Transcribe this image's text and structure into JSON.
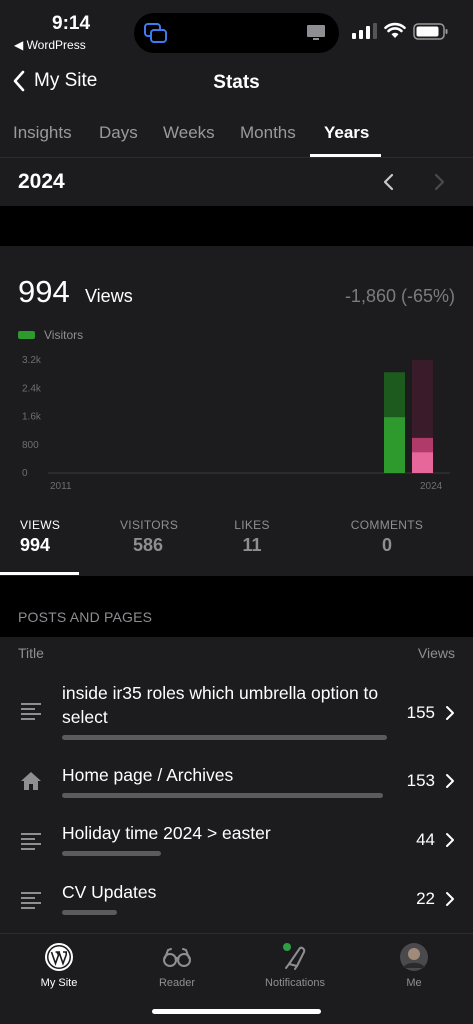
{
  "status_bar": {
    "time": "9:14",
    "back_app": "◀ WordPress"
  },
  "nav": {
    "back_label": "My Site",
    "title": "Stats"
  },
  "tabs": [
    {
      "label": "Insights"
    },
    {
      "label": "Days"
    },
    {
      "label": "Weeks"
    },
    {
      "label": "Months"
    },
    {
      "label": "Years",
      "active": true
    }
  ],
  "period": {
    "label": "2024"
  },
  "summary": {
    "views": "994",
    "views_word": "Views",
    "change": "-1,860 (-65%)"
  },
  "chart_data": {
    "type": "bar",
    "x_labels_shown": [
      "2011",
      "2024"
    ],
    "y_ticks": [
      "3.2k",
      "2.4k",
      "1.6k",
      "800",
      "0"
    ],
    "ylim": [
      0,
      3200
    ],
    "legend": [
      "Visitors"
    ],
    "series": [
      {
        "name": "Visitors",
        "color": "#2e9a2e",
        "bars": [
          {
            "x": "2023",
            "views": 2854,
            "visitors": 1580
          }
        ]
      },
      {
        "name": "Views",
        "color": "#e8679a",
        "bars": [
          {
            "x": "2024",
            "views": 994,
            "visitors": 586
          }
        ]
      }
    ]
  },
  "tiles": [
    {
      "label": "VIEWS",
      "value": "994",
      "active": true
    },
    {
      "label": "VISITORS",
      "value": "586"
    },
    {
      "label": "LIKES",
      "value": "11"
    },
    {
      "label": "COMMENTS",
      "value": "0"
    }
  ],
  "posts": {
    "section_title": "POSTS AND PAGES",
    "col_title": "Title",
    "col_views": "Views",
    "rows": [
      {
        "title": "inside ir35 roles which umbrella option to select",
        "views": "155",
        "icon": "post-lines-icon",
        "bar_fraction": 1.0
      },
      {
        "title": "Home page / Archives",
        "views": "153",
        "icon": "house-icon",
        "bar_fraction": 0.99
      },
      {
        "title": "Holiday time 2024 > easter",
        "views": "44",
        "icon": "post-lines-icon",
        "bar_fraction": 0.28
      },
      {
        "title": "CV Updates",
        "views": "22",
        "icon": "post-lines-icon",
        "bar_fraction": 0.14
      }
    ]
  },
  "tab_bar": [
    {
      "label": "My Site",
      "icon": "wordpress-icon",
      "active": true
    },
    {
      "label": "Reader",
      "icon": "glasses-icon"
    },
    {
      "label": "Notifications",
      "icon": "bell-icon",
      "badge": true
    },
    {
      "label": "Me",
      "icon": "avatar-icon"
    }
  ]
}
